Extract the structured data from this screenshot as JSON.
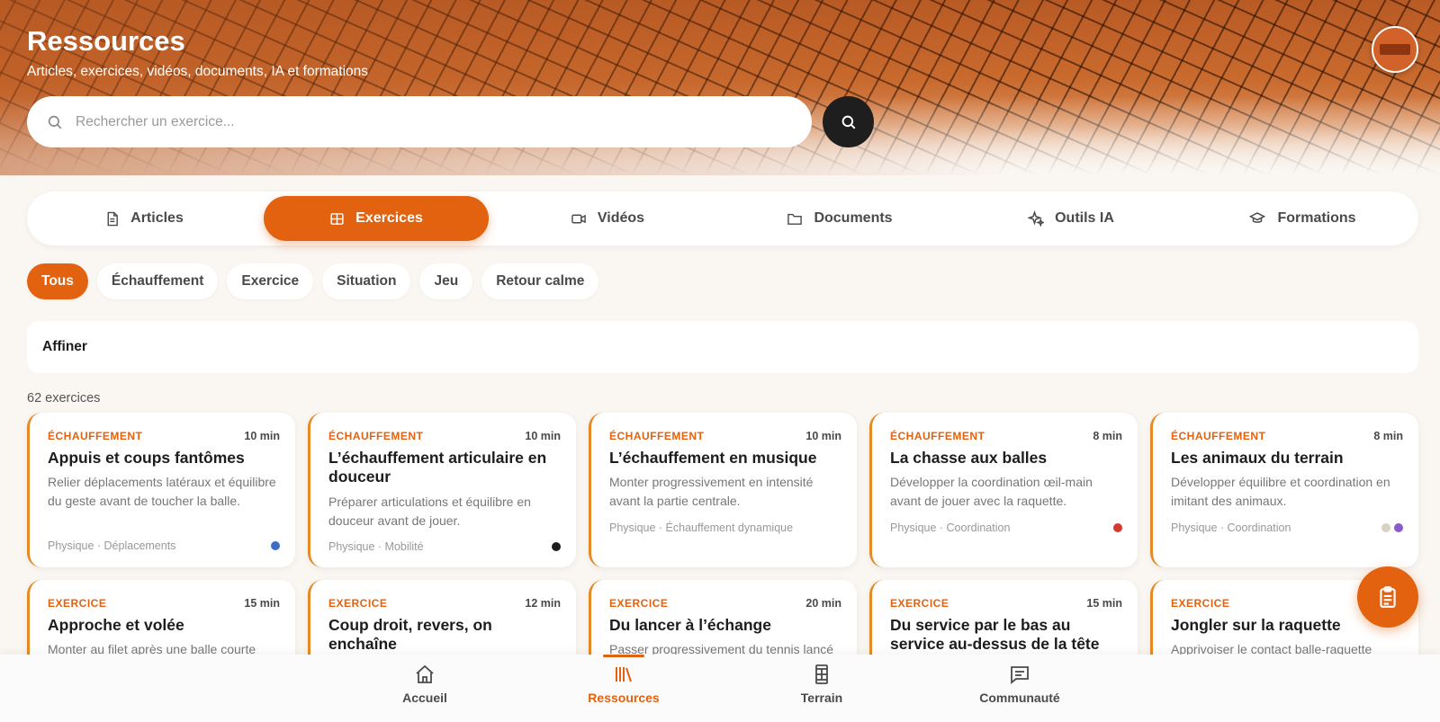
{
  "header": {
    "title": "Ressources",
    "subtitle": "Articles, exercices, vidéos, documents, IA et formations"
  },
  "search": {
    "placeholder": "Rechercher un exercice...",
    "value": ""
  },
  "tabs": [
    {
      "label": "Articles",
      "icon": "document-icon",
      "active": false
    },
    {
      "label": "Exercices",
      "icon": "grid-icon",
      "active": true
    },
    {
      "label": "Vidéos",
      "icon": "video-icon",
      "active": false
    },
    {
      "label": "Documents",
      "icon": "folder-icon",
      "active": false
    },
    {
      "label": "Outils IA",
      "icon": "sparkle-icon",
      "active": false
    },
    {
      "label": "Formations",
      "icon": "graduation-cap-icon",
      "active": false
    }
  ],
  "filters": [
    {
      "label": "Tous",
      "active": true
    },
    {
      "label": "Échauffement",
      "active": false
    },
    {
      "label": "Exercice",
      "active": false
    },
    {
      "label": "Situation",
      "active": false
    },
    {
      "label": "Jeu",
      "active": false
    },
    {
      "label": "Retour calme",
      "active": false
    }
  ],
  "refine": {
    "label": "Affiner"
  },
  "results": {
    "count_label": "62 exercices"
  },
  "cards": [
    {
      "category": "ÉCHAUFFEMENT",
      "duration": "10 min",
      "title": "Appuis et coups fantômes",
      "description": "Relier déplacements latéraux et équilibre du geste avant de toucher la balle.",
      "tags": "Physique · Déplacements",
      "dots": [
        "#3a6fc4"
      ]
    },
    {
      "category": "ÉCHAUFFEMENT",
      "duration": "10 min",
      "title": "L’échauffement articulaire en douceur",
      "description": "Préparer articulations et équilibre en douceur avant de jouer.",
      "tags": "Physique · Mobilité",
      "dots": [
        "#1d1d1d"
      ]
    },
    {
      "category": "ÉCHAUFFEMENT",
      "duration": "10 min",
      "title": "L’échauffement en musique",
      "description": "Monter progressivement en intensité avant la partie centrale.",
      "tags": "Physique · Échauffement dynamique",
      "dots": []
    },
    {
      "category": "ÉCHAUFFEMENT",
      "duration": "8 min",
      "title": "La chasse aux balles",
      "description": "Développer la coordination œil-main avant de jouer avec la raquette.",
      "tags": "Physique · Coordination",
      "dots": [
        "#d63a2f"
      ]
    },
    {
      "category": "ÉCHAUFFEMENT",
      "duration": "8 min",
      "title": "Les animaux du terrain",
      "description": "Développer équilibre et coordination en imitant des animaux.",
      "tags": "Physique · Coordination",
      "dots": [
        "#d8d2c6",
        "#8a5cc8"
      ]
    },
    {
      "category": "EXERCICE",
      "duration": "15 min",
      "title": "Approche et volée",
      "description": "Monter au filet après une balle courte",
      "tags": "",
      "dots": []
    },
    {
      "category": "EXERCICE",
      "duration": "12 min",
      "title": "Coup droit, revers, on enchaîne",
      "description": "",
      "tags": "",
      "dots": []
    },
    {
      "category": "EXERCICE",
      "duration": "20 min",
      "title": "Du lancer à l’échange",
      "description": "Passer progressivement du tennis lancé",
      "tags": "",
      "dots": []
    },
    {
      "category": "EXERCICE",
      "duration": "15 min",
      "title": "Du service par le bas au service au-dessus de la tête",
      "description": "",
      "tags": "",
      "dots": []
    },
    {
      "category": "EXERCICE",
      "duration": "",
      "title": "Jongler sur la raquette",
      "description": "Apprivoiser le contact balle-raquette",
      "tags": "",
      "dots": []
    }
  ],
  "bottom_nav": [
    {
      "label": "Accueil",
      "icon": "home-icon",
      "active": false
    },
    {
      "label": "Ressources",
      "icon": "library-icon",
      "active": true
    },
    {
      "label": "Terrain",
      "icon": "court-icon",
      "active": false
    },
    {
      "label": "Communauté",
      "icon": "chat-icon",
      "active": false
    }
  ],
  "colors": {
    "accent": "#e2620f",
    "card_border": "#e68a26"
  }
}
